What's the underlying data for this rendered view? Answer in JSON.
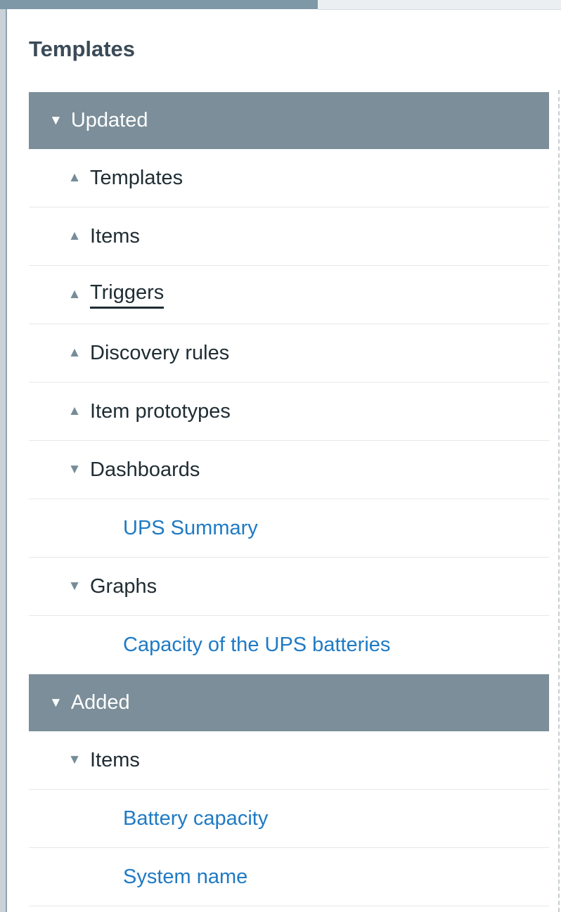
{
  "panel": {
    "title": "Templates"
  },
  "sections": [
    {
      "label": "Updated",
      "groups": [
        {
          "label": "Templates",
          "expanded": false,
          "items": []
        },
        {
          "label": "Items",
          "expanded": false,
          "items": []
        },
        {
          "label": "Triggers",
          "expanded": false,
          "items": []
        },
        {
          "label": "Discovery rules",
          "expanded": false,
          "items": []
        },
        {
          "label": "Item prototypes",
          "expanded": false,
          "items": []
        },
        {
          "label": "Dashboards",
          "expanded": true,
          "items": [
            "UPS Summary"
          ]
        },
        {
          "label": "Graphs",
          "expanded": true,
          "items": [
            "Capacity of the UPS batteries"
          ]
        }
      ]
    },
    {
      "label": "Added",
      "groups": [
        {
          "label": "Items",
          "expanded": true,
          "items": [
            "Battery capacity",
            "System name"
          ]
        }
      ]
    }
  ],
  "icons": {
    "expanded": "triangle-down-icon",
    "collapsed": "triangle-up-icon"
  },
  "colors": {
    "section_header_bg": "#7b8e99",
    "link": "#1f7ac4",
    "title": "#3b4a57"
  }
}
